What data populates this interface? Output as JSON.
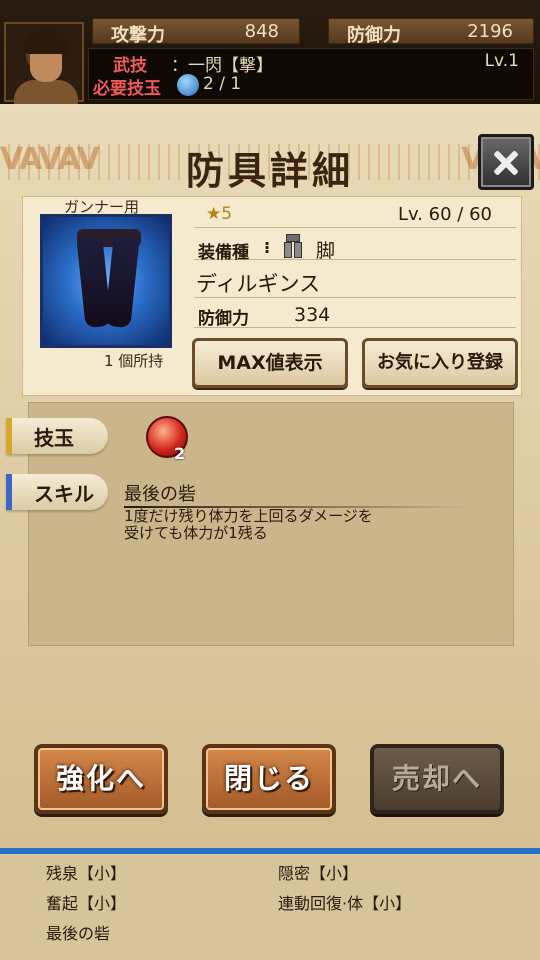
{
  "status": {
    "attack_label": "攻撃力",
    "attack_value": "848",
    "defense_label": "防御力",
    "defense_value": "2196",
    "skill_label": "武技",
    "skill_value": "：一閃【撃】",
    "level": "Lv.1",
    "required_label": "必要技玉",
    "required_value": "2 / 1"
  },
  "panel": {
    "title": "防具詳細",
    "user_type": "ガンナー用",
    "owned": "1 個所持",
    "rarity": "5",
    "level": "Lv. 60 / 60",
    "equip_label": "装備種",
    "equip_value": "脚",
    "name": "ディルギンス",
    "defense_label": "防御力",
    "defense_value": "334",
    "max_button": "MAX値表示",
    "favorite_button": "お気に入り登録"
  },
  "detail": {
    "gem_label": "技玉",
    "gem_count": "2",
    "skill_label": "スキル",
    "skill_name": "最後の砦",
    "skill_desc_1": "1度だけ残り体力を上回るダメージを",
    "skill_desc_2": "受けても体力が1残る"
  },
  "actions": {
    "enhance": "強化へ",
    "close": "閉じる",
    "sell": "売却へ"
  },
  "bottom_list": {
    "left": [
      "残泉【小】",
      "奮起【小】",
      "最後の砦"
    ],
    "right": [
      "隠密【小】",
      "連動回復·体【小】"
    ]
  },
  "colors": {
    "accent_orange": "#c07535",
    "star": "#b5850f",
    "blue_bar": "#2a6fc6"
  }
}
